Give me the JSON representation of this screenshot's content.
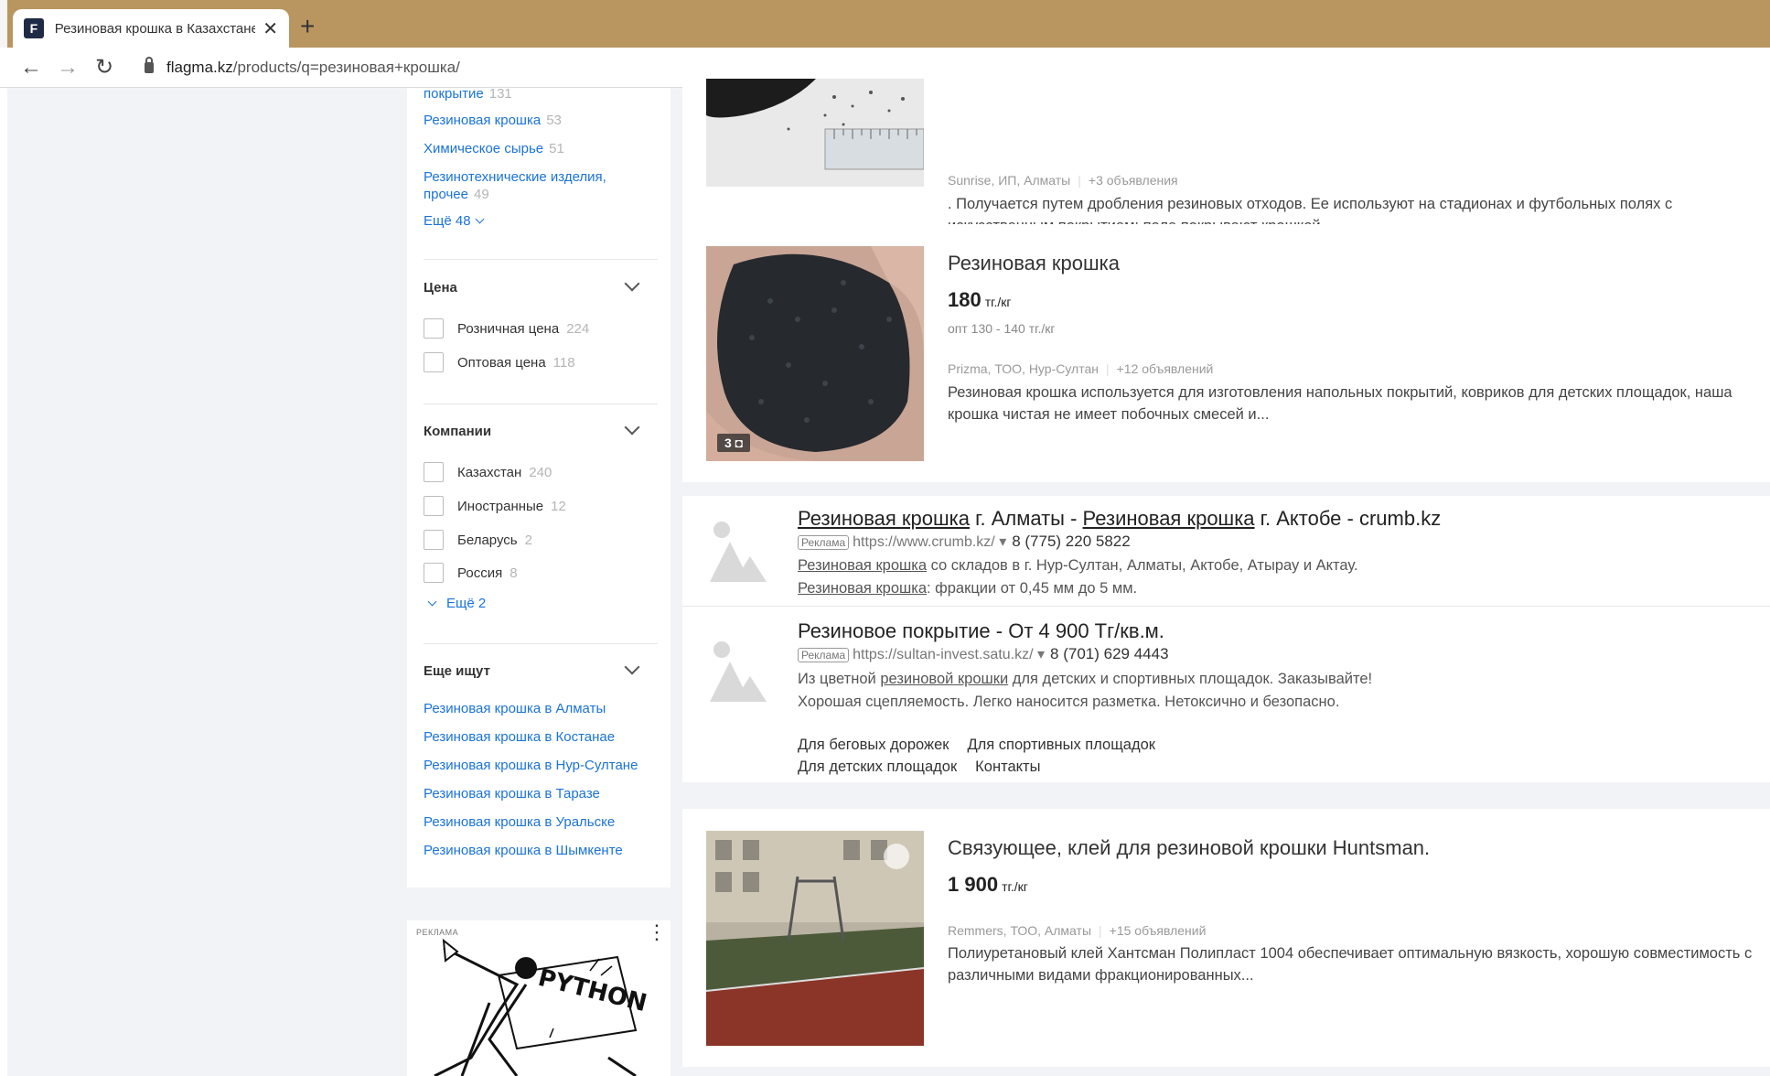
{
  "browser": {
    "tab_title": "Резиновая крошка в Казахстане",
    "tab_close": "✕",
    "new_tab": "+",
    "back": "←",
    "forward": "→",
    "reload": "↻",
    "url_domain": "flagma.kz",
    "url_path": "/products/q=резиновая+крошка/"
  },
  "sidebar": {
    "category_links": [
      {
        "label": "покрытие",
        "count": "131"
      },
      {
        "label": "Резиновая крошка",
        "count": "53"
      },
      {
        "label": "Химическое сырье",
        "count": "51"
      },
      {
        "label": "Резинотехнические изделия,",
        "label2": "прочее",
        "count": "49"
      }
    ],
    "more_categories": "Ещё 48",
    "price": {
      "heading": "Цена",
      "options": [
        {
          "label": "Розничная цена",
          "count": "224"
        },
        {
          "label": "Оптовая цена",
          "count": "118"
        }
      ]
    },
    "companies": {
      "heading": "Компании",
      "options": [
        {
          "label": "Казахстан",
          "count": "240"
        },
        {
          "label": "Иностранные",
          "count": "12"
        },
        {
          "label": "Беларусь",
          "count": "2"
        },
        {
          "label": "Россия",
          "count": "8"
        }
      ],
      "more": "Ещё 2"
    },
    "also_search": {
      "heading": "Еще ищут",
      "links": [
        "Резиновая крошка в Алматы",
        "Резиновая крошка в Костанае",
        "Резиновая крошка в Нур-Султане",
        "Резиновая крошка в Таразе",
        "Резиновая крошка в Уральске",
        "Резиновая крошка в Шымкенте"
      ]
    },
    "ad": {
      "label": "РЕКЛАМА",
      "menu": "⋮",
      "banner_text": "PYTHON"
    }
  },
  "listings": [
    {
      "seller": "Sunrise, ИП, Алматы",
      "more": "+3 объявления",
      "desc": ". Получается путем дробления резиновых отходов. Ее используют на стадионах и футбольных полях с искусственным покрытием: поле покрывают крошкой,..."
    },
    {
      "title": "Резиновая крошка",
      "price": "180",
      "unit": "тг./кг",
      "wholesale": "опт 130 - 140 тг./кг",
      "seller": "Prizma, ТОО, Нур-Султан",
      "more": "+12 объявлений",
      "desc": "Резиновая крошка используется для изготовления напольных покрытий, ковриков для детских площадок, наша крошка чистая не имеет побочных смесей и...",
      "photo_count": "3"
    },
    {
      "title": "Связующее, клей для резиновой крошки Huntsman.",
      "price": "1 900",
      "unit": "тг./кг",
      "seller": "Remmers, ТОО, Алматы",
      "more": "+15 объявлений",
      "desc": "Полиуретановый клей Хантсман Полипласт 1004 обеспечивает оптимальную вязкость, хорошую совместимость с различными видами фракционированных..."
    }
  ],
  "ads": [
    {
      "title_u1": "Резиновая крошка",
      "title_t1": " г. Алматы - ",
      "title_u2": "Резиновая крошка",
      "title_t2": " г. Актобе - crumb.kz",
      "tag": "Реклама",
      "url": "https://www.crumb.kz/",
      "arrow": "▾",
      "phone": "8 (775) 220 5822",
      "line1_u": "Резиновая крошка",
      "line1_t": " со складов в г. Нур-Султан, Алматы, Актобе, Атырау и Актау.",
      "line2_u": "Резиновая крошка",
      "line2_t": ": фракции от 0,45 мм до 5 мм."
    },
    {
      "title": "Резиновое покрытие - От 4 900 Тг/кв.м.",
      "tag": "Реклама",
      "url": "https://sultan-invest.satu.kz/",
      "arrow": "▾",
      "phone": "8 (701) 629 4443",
      "line1_t1": "Из цветной ",
      "line1_u": "резиновой крошки",
      "line1_t2": " для детских и спортивных площадок. Заказывайте!",
      "line2": "Хорошая сцепляемость. Легко наносится разметка. Нетоксично и безопасно.",
      "links": [
        "Для беговых дорожек",
        "Для спортивных площадок",
        "Для детских площадок",
        "Контакты"
      ]
    }
  ]
}
